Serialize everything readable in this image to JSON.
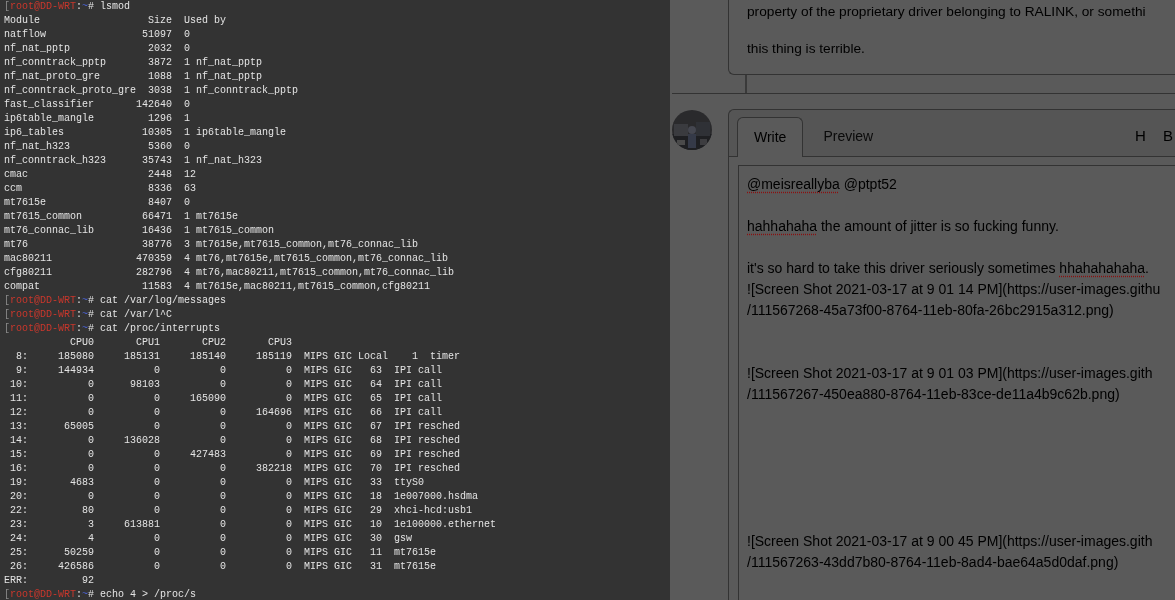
{
  "terminal": {
    "lines": [
      {
        "kind": "prompt",
        "segments": [
          {
            "kind": "bracket",
            "text": "["
          },
          {
            "kind": "user",
            "text": "root@DD-WRT"
          },
          {
            "kind": "plain",
            "text": ":"
          },
          {
            "kind": "path",
            "text": "~"
          },
          {
            "kind": "plain",
            "text": "# lsmod"
          }
        ]
      },
      {
        "kind": "module_header",
        "columns": [
          "Module",
          "Size",
          "Used by"
        ]
      },
      {
        "kind": "module",
        "module": "natflow",
        "size": "51097",
        "used_by": "0"
      },
      {
        "kind": "module",
        "module": "nf_nat_pptp",
        "size": "2032",
        "used_by": "0"
      },
      {
        "kind": "module",
        "module": "nf_conntrack_pptp",
        "size": "3872",
        "used_by": "1 nf_nat_pptp"
      },
      {
        "kind": "module",
        "module": "nf_nat_proto_gre",
        "size": "1088",
        "used_by": "1 nf_nat_pptp"
      },
      {
        "kind": "module",
        "module": "nf_conntrack_proto_gre",
        "size": "3038",
        "used_by": "1 nf_conntrack_pptp"
      },
      {
        "kind": "module",
        "module": "fast_classifier",
        "size": "142640",
        "used_by": "0"
      },
      {
        "kind": "module",
        "module": "ip6table_mangle",
        "size": "1296",
        "used_by": "1"
      },
      {
        "kind": "module",
        "module": "ip6_tables",
        "size": "10305",
        "used_by": "1 ip6table_mangle"
      },
      {
        "kind": "module",
        "module": "nf_nat_h323",
        "size": "5360",
        "used_by": "0"
      },
      {
        "kind": "module",
        "module": "nf_conntrack_h323",
        "size": "35743",
        "used_by": "1 nf_nat_h323"
      },
      {
        "kind": "module",
        "module": "cmac",
        "size": "2448",
        "used_by": "12"
      },
      {
        "kind": "module",
        "module": "ccm",
        "size": "8336",
        "used_by": "63"
      },
      {
        "kind": "module",
        "module": "mt7615e",
        "size": "8407",
        "used_by": "0"
      },
      {
        "kind": "module",
        "module": "mt7615_common",
        "size": "66471",
        "used_by": "1 mt7615e"
      },
      {
        "kind": "module",
        "module": "mt76_connac_lib",
        "size": "16436",
        "used_by": "1 mt7615_common"
      },
      {
        "kind": "module",
        "module": "mt76",
        "size": "38776",
        "used_by": "3 mt7615e,mt7615_common,mt76_connac_lib"
      },
      {
        "kind": "module",
        "module": "mac80211",
        "size": "470359",
        "used_by": "4 mt76,mt7615e,mt7615_common,mt76_connac_lib"
      },
      {
        "kind": "module",
        "module": "cfg80211",
        "size": "282796",
        "used_by": "4 mt76,mac80211,mt7615_common,mt76_connac_lib"
      },
      {
        "kind": "module",
        "module": "compat",
        "size": "11583",
        "used_by": "4 mt7615e,mac80211,mt7615_common,cfg80211"
      },
      {
        "kind": "prompt",
        "segments": [
          {
            "kind": "bracket",
            "text": "["
          },
          {
            "kind": "user",
            "text": "root@DD-WRT"
          },
          {
            "kind": "plain",
            "text": ":"
          },
          {
            "kind": "path",
            "text": "~"
          },
          {
            "kind": "plain",
            "text": "# cat /var/log/messages"
          }
        ]
      },
      {
        "kind": "prompt",
        "segments": [
          {
            "kind": "bracket",
            "text": "["
          },
          {
            "kind": "user",
            "text": "root@DD-WRT"
          },
          {
            "kind": "plain",
            "text": ":"
          },
          {
            "kind": "path",
            "text": "~"
          },
          {
            "kind": "plain",
            "text": "# cat /var/l^C"
          }
        ]
      },
      {
        "kind": "prompt",
        "segments": [
          {
            "kind": "bracket",
            "text": "["
          },
          {
            "kind": "user",
            "text": "root@DD-WRT"
          },
          {
            "kind": "plain",
            "text": ":"
          },
          {
            "kind": "path",
            "text": "~"
          },
          {
            "kind": "plain",
            "text": "# cat /proc/interrupts"
          }
        ]
      },
      {
        "kind": "irq_header",
        "cpus": [
          "CPU0",
          "CPU1",
          "CPU2",
          "CPU3"
        ]
      },
      {
        "kind": "irq",
        "irq": "8:",
        "counts": [
          "185080",
          "185131",
          "185140",
          "185119"
        ],
        "controller": "MIPS GIC Local",
        "hwirq": "1",
        "name": "timer"
      },
      {
        "kind": "irq",
        "irq": "9:",
        "counts": [
          "144934",
          "0",
          "0",
          "0"
        ],
        "controller": "MIPS GIC",
        "hwirq": "63",
        "name": "IPI call"
      },
      {
        "kind": "irq",
        "irq": "10:",
        "counts": [
          "0",
          "98103",
          "0",
          "0"
        ],
        "controller": "MIPS GIC",
        "hwirq": "64",
        "name": "IPI call"
      },
      {
        "kind": "irq",
        "irq": "11:",
        "counts": [
          "0",
          "0",
          "165090",
          "0"
        ],
        "controller": "MIPS GIC",
        "hwirq": "65",
        "name": "IPI call"
      },
      {
        "kind": "irq",
        "irq": "12:",
        "counts": [
          "0",
          "0",
          "0",
          "164696"
        ],
        "controller": "MIPS GIC",
        "hwirq": "66",
        "name": "IPI call"
      },
      {
        "kind": "irq",
        "irq": "13:",
        "counts": [
          "65005",
          "0",
          "0",
          "0"
        ],
        "controller": "MIPS GIC",
        "hwirq": "67",
        "name": "IPI resched"
      },
      {
        "kind": "irq",
        "irq": "14:",
        "counts": [
          "0",
          "136028",
          "0",
          "0"
        ],
        "controller": "MIPS GIC",
        "hwirq": "68",
        "name": "IPI resched"
      },
      {
        "kind": "irq",
        "irq": "15:",
        "counts": [
          "0",
          "0",
          "427483",
          "0"
        ],
        "controller": "MIPS GIC",
        "hwirq": "69",
        "name": "IPI resched"
      },
      {
        "kind": "irq",
        "irq": "16:",
        "counts": [
          "0",
          "0",
          "0",
          "382218"
        ],
        "controller": "MIPS GIC",
        "hwirq": "70",
        "name": "IPI resched"
      },
      {
        "kind": "irq",
        "irq": "19:",
        "counts": [
          "4683",
          "0",
          "0",
          "0"
        ],
        "controller": "MIPS GIC",
        "hwirq": "33",
        "name": "ttyS0"
      },
      {
        "kind": "irq",
        "irq": "20:",
        "counts": [
          "0",
          "0",
          "0",
          "0"
        ],
        "controller": "MIPS GIC",
        "hwirq": "18",
        "name": "1e007000.hsdma"
      },
      {
        "kind": "irq",
        "irq": "22:",
        "counts": [
          "80",
          "0",
          "0",
          "0"
        ],
        "controller": "MIPS GIC",
        "hwirq": "29",
        "name": "xhci-hcd:usb1"
      },
      {
        "kind": "irq",
        "irq": "23:",
        "counts": [
          "3",
          "613881",
          "0",
          "0"
        ],
        "controller": "MIPS GIC",
        "hwirq": "10",
        "name": "1e100000.ethernet"
      },
      {
        "kind": "irq",
        "irq": "24:",
        "counts": [
          "4",
          "0",
          "0",
          "0"
        ],
        "controller": "MIPS GIC",
        "hwirq": "30",
        "name": "gsw"
      },
      {
        "kind": "irq",
        "irq": "25:",
        "counts": [
          "50259",
          "0",
          "0",
          "0"
        ],
        "controller": "MIPS GIC",
        "hwirq": "11",
        "name": "mt7615e"
      },
      {
        "kind": "irq",
        "irq": "26:",
        "counts": [
          "426586",
          "0",
          "0",
          "0"
        ],
        "controller": "MIPS GIC",
        "hwirq": "31",
        "name": "mt7615e"
      },
      {
        "kind": "irq",
        "irq": "ERR:",
        "counts": [
          "92"
        ]
      },
      {
        "kind": "prompt",
        "segments": [
          {
            "kind": "bracket",
            "text": "["
          },
          {
            "kind": "user",
            "text": "root@DD-WRT"
          },
          {
            "kind": "plain",
            "text": ":"
          },
          {
            "kind": "path",
            "text": "~"
          },
          {
            "kind": "plain",
            "text": "# echo 4 > /proc/s"
          }
        ]
      }
    ]
  },
  "comment": {
    "paragraphs": [
      "property of the proprietary driver belonging to RALINK, or somethi",
      "this thing is terrible."
    ]
  },
  "new_comment": {
    "avatar": {
      "kind": "picture"
    },
    "tabs": [
      {
        "label": "Write",
        "selected": true
      },
      {
        "label": "Preview",
        "selected": false
      }
    ],
    "toolbar": [
      "H",
      "B"
    ],
    "text": [
      {
        "text": "@meisreallyba",
        "misspelled": true
      },
      {
        "text": " @ptpt52\n\n",
        "misspelled": false
      },
      {
        "text": "hahhahaha",
        "misspelled": true
      },
      {
        "text": " the amount of jitter is so fucking funny.\n\nit's so hard to take this driver seriously sometimes ",
        "misspelled": false
      },
      {
        "text": "hhahahahaha",
        "misspelled": true
      },
      {
        "text": ".\n![Screen Shot 2021-03-17 at 9 01 14 PM](https://user-images.githu\n/111567268-45a73f00-8764-11eb-80fa-26bc2915a312.png)\n\n\n![Screen Shot 2021-03-17 at 9 01 03 PM](https://user-images.gith\n/111567267-450ea880-8764-11eb-83ce-de11a4b9c62b.png)\n\n\n\n\n\n\n![Screen Shot 2021-03-17 at 9 00 45 PM](https://user-images.gith\n/111567263-43dd7b80-8764-11eb-8ad4-bae64a5d0daf.png)",
        "misspelled": false
      }
    ]
  }
}
